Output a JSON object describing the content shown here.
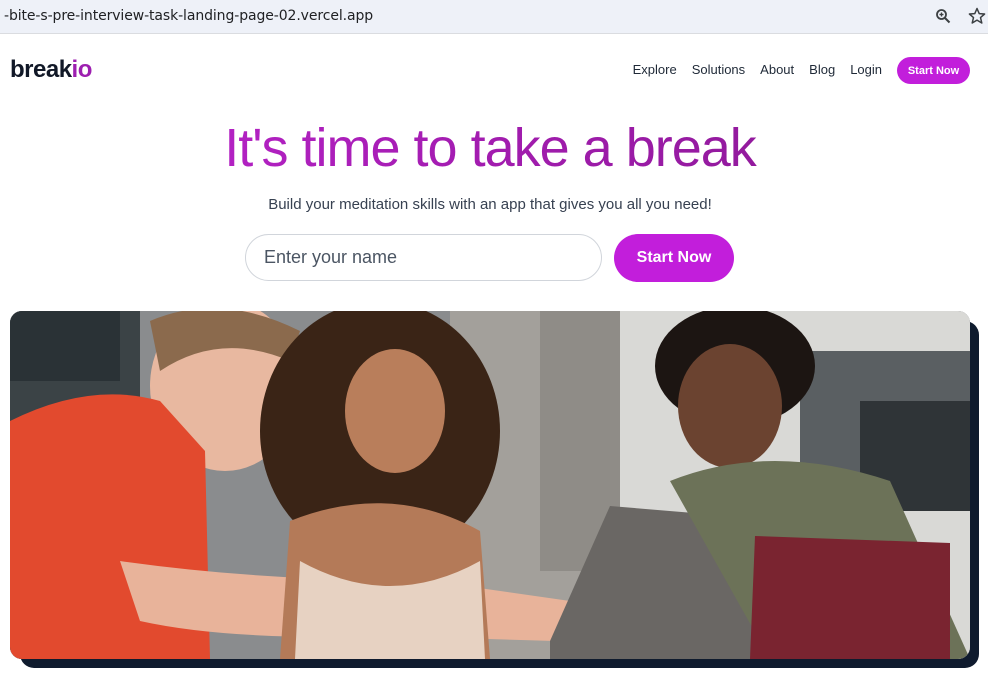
{
  "browser": {
    "url": "-bite-s-pre-interview-task-landing-page-02.vercel.app",
    "icons": [
      "zoom-icon",
      "star-icon"
    ]
  },
  "nav": {
    "logo_main": "break",
    "logo_accent": "io",
    "links": [
      "Explore",
      "Solutions",
      "About",
      "Blog",
      "Login"
    ],
    "cta": "Start Now"
  },
  "hero": {
    "title": "It's time to take a break",
    "subtitle": "Build your meditation skills with an app that gives you all you need!",
    "input_placeholder": "Enter your name",
    "cta": "Start Now",
    "image_alt": "Three young people looking at laptops together"
  },
  "colors": {
    "brand": "#c21edb",
    "accent_text": "#9d1fb0",
    "title_gradient_start": "#c026d3",
    "title_gradient_end": "#86198f",
    "image_shadow": "#0f1b2e"
  }
}
